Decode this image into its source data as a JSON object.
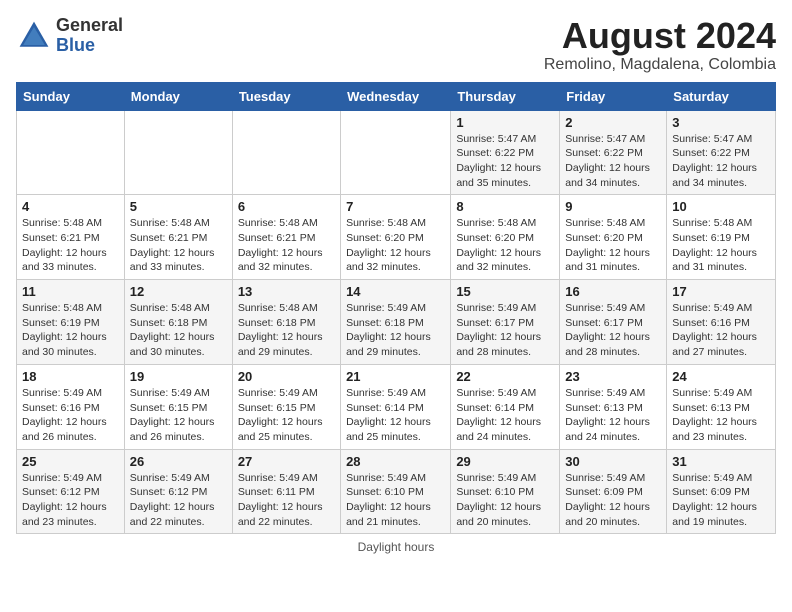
{
  "header": {
    "logo_general": "General",
    "logo_blue": "Blue",
    "month_year": "August 2024",
    "location": "Remolino, Magdalena, Colombia"
  },
  "footer": {
    "note": "Daylight hours"
  },
  "days_of_week": [
    "Sunday",
    "Monday",
    "Tuesday",
    "Wednesday",
    "Thursday",
    "Friday",
    "Saturday"
  ],
  "weeks": [
    [
      {
        "day": "",
        "info": ""
      },
      {
        "day": "",
        "info": ""
      },
      {
        "day": "",
        "info": ""
      },
      {
        "day": "",
        "info": ""
      },
      {
        "day": "1",
        "info": "Sunrise: 5:47 AM\nSunset: 6:22 PM\nDaylight: 12 hours\nand 35 minutes."
      },
      {
        "day": "2",
        "info": "Sunrise: 5:47 AM\nSunset: 6:22 PM\nDaylight: 12 hours\nand 34 minutes."
      },
      {
        "day": "3",
        "info": "Sunrise: 5:47 AM\nSunset: 6:22 PM\nDaylight: 12 hours\nand 34 minutes."
      }
    ],
    [
      {
        "day": "4",
        "info": "Sunrise: 5:48 AM\nSunset: 6:21 PM\nDaylight: 12 hours\nand 33 minutes."
      },
      {
        "day": "5",
        "info": "Sunrise: 5:48 AM\nSunset: 6:21 PM\nDaylight: 12 hours\nand 33 minutes."
      },
      {
        "day": "6",
        "info": "Sunrise: 5:48 AM\nSunset: 6:21 PM\nDaylight: 12 hours\nand 32 minutes."
      },
      {
        "day": "7",
        "info": "Sunrise: 5:48 AM\nSunset: 6:20 PM\nDaylight: 12 hours\nand 32 minutes."
      },
      {
        "day": "8",
        "info": "Sunrise: 5:48 AM\nSunset: 6:20 PM\nDaylight: 12 hours\nand 32 minutes."
      },
      {
        "day": "9",
        "info": "Sunrise: 5:48 AM\nSunset: 6:20 PM\nDaylight: 12 hours\nand 31 minutes."
      },
      {
        "day": "10",
        "info": "Sunrise: 5:48 AM\nSunset: 6:19 PM\nDaylight: 12 hours\nand 31 minutes."
      }
    ],
    [
      {
        "day": "11",
        "info": "Sunrise: 5:48 AM\nSunset: 6:19 PM\nDaylight: 12 hours\nand 30 minutes."
      },
      {
        "day": "12",
        "info": "Sunrise: 5:48 AM\nSunset: 6:18 PM\nDaylight: 12 hours\nand 30 minutes."
      },
      {
        "day": "13",
        "info": "Sunrise: 5:48 AM\nSunset: 6:18 PM\nDaylight: 12 hours\nand 29 minutes."
      },
      {
        "day": "14",
        "info": "Sunrise: 5:49 AM\nSunset: 6:18 PM\nDaylight: 12 hours\nand 29 minutes."
      },
      {
        "day": "15",
        "info": "Sunrise: 5:49 AM\nSunset: 6:17 PM\nDaylight: 12 hours\nand 28 minutes."
      },
      {
        "day": "16",
        "info": "Sunrise: 5:49 AM\nSunset: 6:17 PM\nDaylight: 12 hours\nand 28 minutes."
      },
      {
        "day": "17",
        "info": "Sunrise: 5:49 AM\nSunset: 6:16 PM\nDaylight: 12 hours\nand 27 minutes."
      }
    ],
    [
      {
        "day": "18",
        "info": "Sunrise: 5:49 AM\nSunset: 6:16 PM\nDaylight: 12 hours\nand 26 minutes."
      },
      {
        "day": "19",
        "info": "Sunrise: 5:49 AM\nSunset: 6:15 PM\nDaylight: 12 hours\nand 26 minutes."
      },
      {
        "day": "20",
        "info": "Sunrise: 5:49 AM\nSunset: 6:15 PM\nDaylight: 12 hours\nand 25 minutes."
      },
      {
        "day": "21",
        "info": "Sunrise: 5:49 AM\nSunset: 6:14 PM\nDaylight: 12 hours\nand 25 minutes."
      },
      {
        "day": "22",
        "info": "Sunrise: 5:49 AM\nSunset: 6:14 PM\nDaylight: 12 hours\nand 24 minutes."
      },
      {
        "day": "23",
        "info": "Sunrise: 5:49 AM\nSunset: 6:13 PM\nDaylight: 12 hours\nand 24 minutes."
      },
      {
        "day": "24",
        "info": "Sunrise: 5:49 AM\nSunset: 6:13 PM\nDaylight: 12 hours\nand 23 minutes."
      }
    ],
    [
      {
        "day": "25",
        "info": "Sunrise: 5:49 AM\nSunset: 6:12 PM\nDaylight: 12 hours\nand 23 minutes."
      },
      {
        "day": "26",
        "info": "Sunrise: 5:49 AM\nSunset: 6:12 PM\nDaylight: 12 hours\nand 22 minutes."
      },
      {
        "day": "27",
        "info": "Sunrise: 5:49 AM\nSunset: 6:11 PM\nDaylight: 12 hours\nand 22 minutes."
      },
      {
        "day": "28",
        "info": "Sunrise: 5:49 AM\nSunset: 6:10 PM\nDaylight: 12 hours\nand 21 minutes."
      },
      {
        "day": "29",
        "info": "Sunrise: 5:49 AM\nSunset: 6:10 PM\nDaylight: 12 hours\nand 20 minutes."
      },
      {
        "day": "30",
        "info": "Sunrise: 5:49 AM\nSunset: 6:09 PM\nDaylight: 12 hours\nand 20 minutes."
      },
      {
        "day": "31",
        "info": "Sunrise: 5:49 AM\nSunset: 6:09 PM\nDaylight: 12 hours\nand 19 minutes."
      }
    ]
  ]
}
